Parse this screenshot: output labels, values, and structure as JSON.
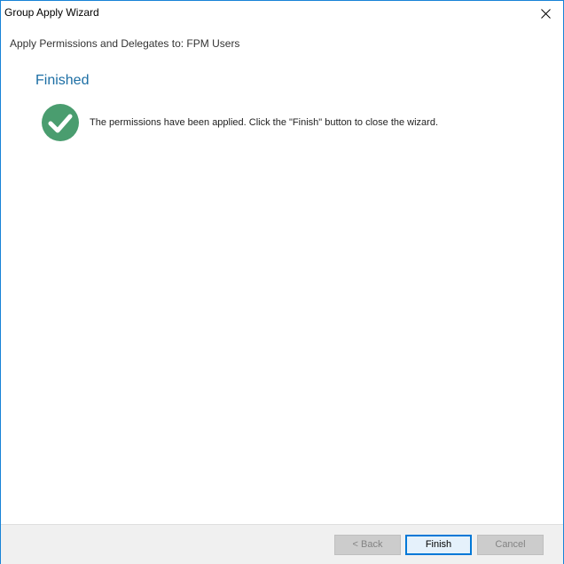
{
  "window": {
    "title": "Group Apply Wizard",
    "accent_color": "#1883d7"
  },
  "header": {
    "text": "Apply Permissions and Delegates to: FPM Users"
  },
  "main": {
    "section_title": "Finished",
    "section_title_color": "#1c6ea4",
    "status_icon": "check-circle-icon",
    "status_icon_color": "#4a9d6f",
    "message": "The permissions have been applied. Click the \"Finish\" button to close the wizard."
  },
  "footer": {
    "back_label": "< Back",
    "back_enabled": false,
    "finish_label": "Finish",
    "finish_enabled": true,
    "cancel_label": "Cancel",
    "cancel_enabled": false
  }
}
